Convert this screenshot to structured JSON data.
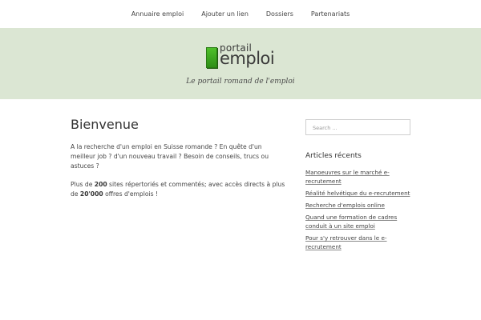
{
  "nav": {
    "items": [
      "Annuaire emploi",
      "Ajouter un lien",
      "Dossiers",
      "Partenariats"
    ]
  },
  "header": {
    "logo_top": "portail",
    "logo_bottom": "emploi",
    "tagline": "Le portail romand de l'emploi",
    "background": "#dbe6d3",
    "logo_color": "#3fa81f"
  },
  "main": {
    "title": "Bienvenue",
    "para1": "A la recherche d'un emploi en Suisse romande ? En quête d'un meilleur job ? d'un nouveau travail ? Besoin de conseils, trucs ou astuces ?",
    "para2_pre": "Plus de ",
    "para2_num1": "200",
    "para2_mid": " sites répertoriés et commentés; avec accès directs à plus de ",
    "para2_num2": "20'000",
    "para2_post": " offres d'emplois !"
  },
  "sidebar": {
    "search_placeholder": "Search ...",
    "recent_title": "Articles récents",
    "recent": [
      "Manoeuvres sur le marché e-recrutement",
      "Réalité helvétique du e-recrutement",
      "Recherche d'emplois online",
      "Quand une formation de cadres conduit à un site emploi",
      "Pour s'y retrouver dans le e-recrutement"
    ]
  }
}
